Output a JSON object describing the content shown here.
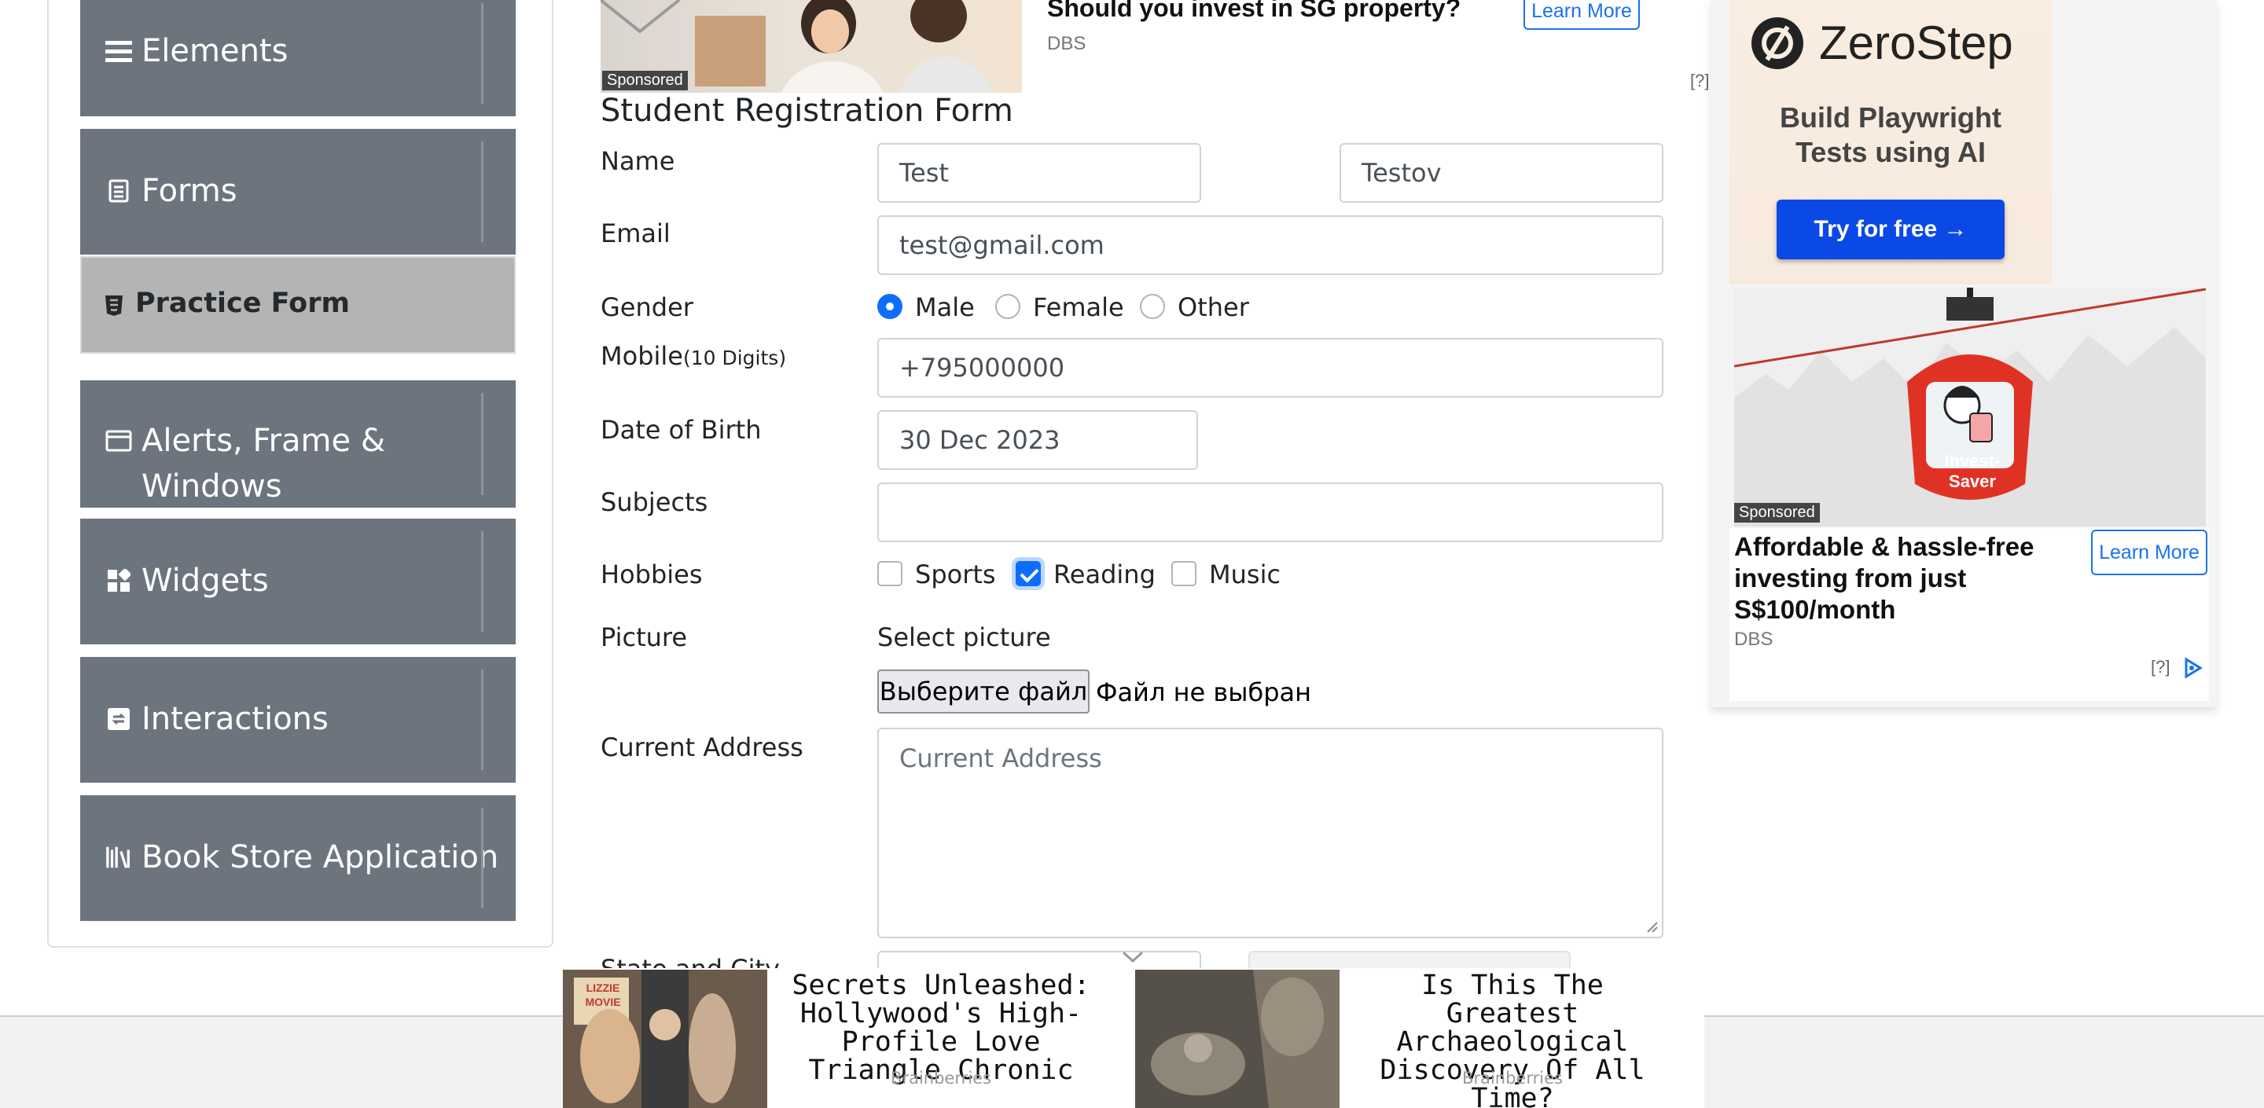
{
  "sidebar": {
    "groups": [
      {
        "label": "Elements"
      },
      {
        "label": "Forms"
      },
      {
        "label": "Alerts, Frame &"
      },
      {
        "label": "Windows"
      },
      {
        "label": "Widgets"
      },
      {
        "label": "Interactions"
      },
      {
        "label": "Book Store Application"
      }
    ],
    "active_item": "Practice Form"
  },
  "top_ad": {
    "headline": "Should you invest in SG property?",
    "advertiser": "DBS",
    "cta": "Learn More",
    "sponsored": "Sponsored",
    "info": "[?]"
  },
  "form": {
    "title": "Student Registration Form",
    "name_label": "Name",
    "first_name": "Test",
    "last_name": "Testov",
    "email_label": "Email",
    "email": "test@gmail.com",
    "gender_label": "Gender",
    "gender_options": [
      "Male",
      "Female",
      "Other"
    ],
    "gender_selected": "Male",
    "mobile_label": "Mobile",
    "mobile_hint": "(10 Digits)",
    "mobile": "+795000000",
    "dob_label": "Date of Birth",
    "dob": "30 Dec 2023",
    "subjects_label": "Subjects",
    "subjects": "",
    "hobbies_label": "Hobbies",
    "hobbies": [
      {
        "label": "Sports",
        "checked": false
      },
      {
        "label": "Reading",
        "checked": true
      },
      {
        "label": "Music",
        "checked": false
      }
    ],
    "picture_label": "Picture",
    "select_picture": "Select picture",
    "file_button": "Выберите файл",
    "file_status": "Файл не выбран",
    "address_label": "Current Address",
    "address_placeholder": "Current Address",
    "state_city_label": "State and City"
  },
  "right_ad": {
    "brand": "ZeroStep",
    "tagline": "Build Playwright Tests using AI",
    "cta": "Try for free →",
    "gondola_text": "Invest-Saver",
    "sponsored": "Sponsored",
    "headline": "Affordable & hassle-free investing from just S$100/month",
    "advertiser": "DBS",
    "learn_more": "Learn More",
    "info": "[?]"
  },
  "bottom_ads": [
    {
      "headline": "Secrets Unleashed: Hollywood's High-Profile Love Triangle Chronic",
      "source": "Brainberries",
      "thumb_text": "LIZZIE MOVIE"
    },
    {
      "headline": "Is This The Greatest Archaeological Discovery Of All Time?",
      "source": "Brainberries"
    }
  ],
  "colors": {
    "sidebar_bg": "#6c757d",
    "active_item_bg": "#b4b4b4",
    "primary": "#0d6efd",
    "zerostep_button": "#0b49e6"
  }
}
